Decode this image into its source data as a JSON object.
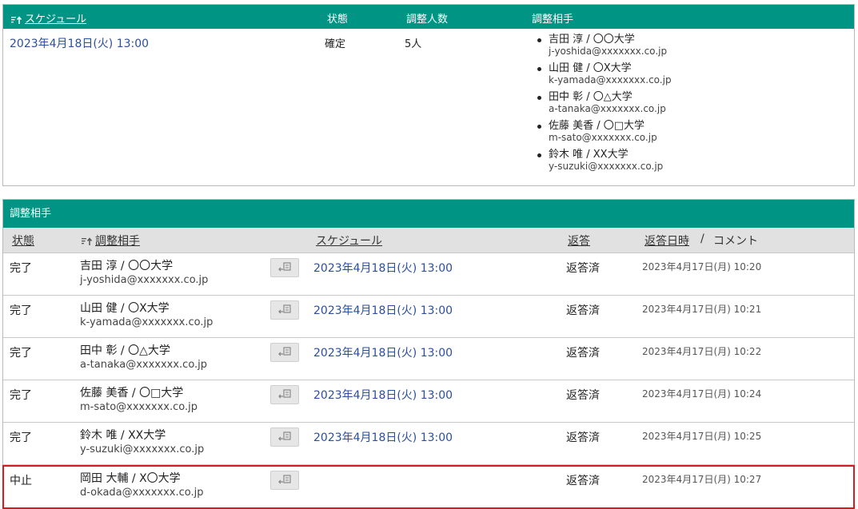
{
  "schedule_table": {
    "headers": {
      "schedule": "スケジュール",
      "status": "状態",
      "count": "調整人数",
      "partners": "調整相手"
    },
    "row": {
      "datetime": "2023年4月18日(火) 13:00",
      "status": "確定",
      "count": "5人",
      "partners": [
        {
          "name": "吉田 淳 / 〇〇大学",
          "email": "j-yoshida@xxxxxxx.co.jp"
        },
        {
          "name": "山田 健 / 〇X大学",
          "email": "k-yamada@xxxxxxx.co.jp"
        },
        {
          "name": "田中 彰 / 〇△大学",
          "email": "a-tanaka@xxxxxxx.co.jp"
        },
        {
          "name": "佐藤 美香 / 〇□大学",
          "email": "m-sato@xxxxxxx.co.jp"
        },
        {
          "name": "鈴木 唯 / XX大学",
          "email": "y-suzuki@xxxxxxx.co.jp"
        }
      ]
    }
  },
  "partner_table": {
    "title": "調整相手",
    "headers": {
      "status": "状態",
      "partner": "調整相手",
      "schedule": "スケジュール",
      "reply": "返答",
      "reply_date": "返答日時",
      "separator": "/",
      "comment": "コメント"
    },
    "rows": [
      {
        "status": "完了",
        "name": "吉田 淳 / 〇〇大学",
        "email": "j-yoshida@xxxxxxx.co.jp",
        "schedule": "2023年4月18日(火) 13:00",
        "reply": "返答済",
        "reply_date": "2023年4月17日(月) 10:20"
      },
      {
        "status": "完了",
        "name": "山田 健 / 〇X大学",
        "email": "k-yamada@xxxxxxx.co.jp",
        "schedule": "2023年4月18日(火) 13:00",
        "reply": "返答済",
        "reply_date": "2023年4月17日(月) 10:21"
      },
      {
        "status": "完了",
        "name": "田中 彰 / 〇△大学",
        "email": "a-tanaka@xxxxxxx.co.jp",
        "schedule": "2023年4月18日(火) 13:00",
        "reply": "返答済",
        "reply_date": "2023年4月17日(月) 10:22"
      },
      {
        "status": "完了",
        "name": "佐藤 美香 / 〇□大学",
        "email": "m-sato@xxxxxxx.co.jp",
        "schedule": "2023年4月18日(火) 13:00",
        "reply": "返答済",
        "reply_date": "2023年4月17日(月) 10:24"
      },
      {
        "status": "完了",
        "name": "鈴木 唯 / XX大学",
        "email": "y-suzuki@xxxxxxx.co.jp",
        "schedule": "2023年4月18日(火) 13:00",
        "reply": "返答済",
        "reply_date": "2023年4月17日(月) 10:25"
      },
      {
        "status": "中止",
        "name": "岡田 大輔 / X〇大学",
        "email": "d-okada@xxxxxxx.co.jp",
        "schedule": "",
        "reply": "返答済",
        "reply_date": "2023年4月17日(月) 10:27"
      }
    ]
  },
  "icons": {
    "sort": "sort-icon",
    "comment_button": "comment-reply-icon"
  },
  "colors": {
    "header_teal": "#009485",
    "link_blue": "#2b4f9e",
    "highlight_red": "#d71920",
    "subheader_gray": "#e1e1e1"
  }
}
